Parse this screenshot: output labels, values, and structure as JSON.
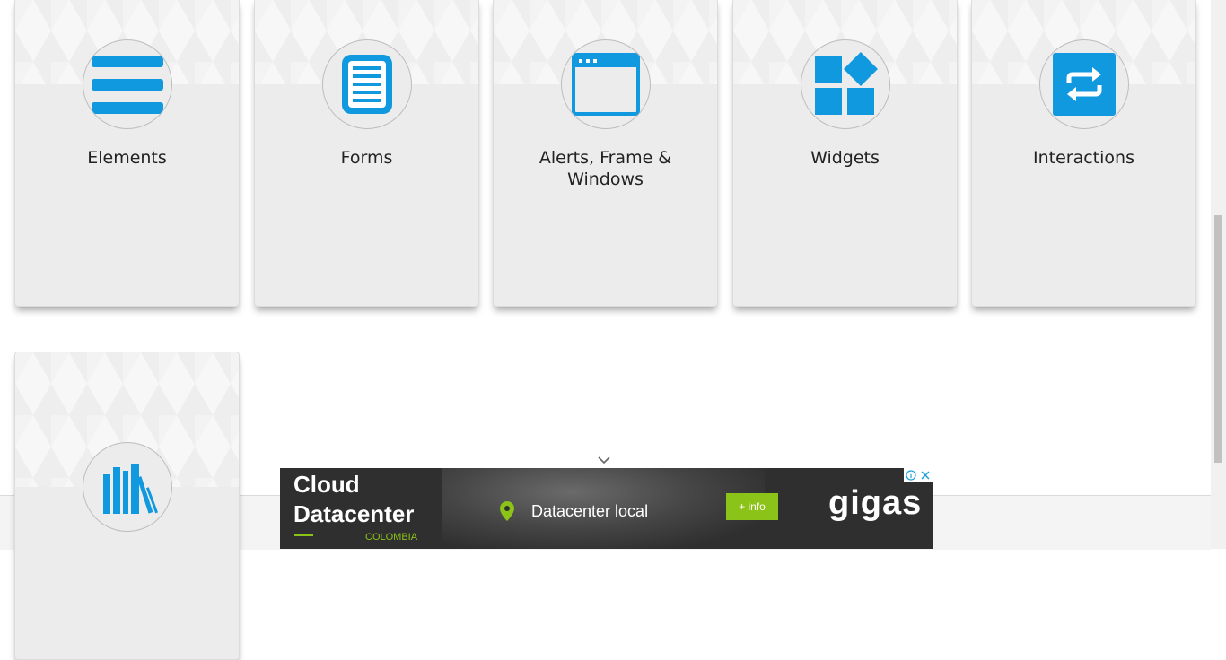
{
  "cards": [
    {
      "title": "Elements",
      "icon": "hamburger-menu-icon"
    },
    {
      "title": "Forms",
      "icon": "document-list-icon"
    },
    {
      "title": "Alerts, Frame & Windows",
      "icon": "browser-window-icon"
    },
    {
      "title": "Widgets",
      "icon": "widgets-blocks-icon"
    },
    {
      "title": "Interactions",
      "icon": "repeat-arrows-icon"
    },
    {
      "title": "",
      "icon": "book-shelf-icon"
    }
  ],
  "ad": {
    "headline_line1": "Cloud",
    "headline_line2": "Datacenter",
    "country": "COLOMBIA",
    "location_text": "Datacenter local",
    "cta": "+ info",
    "brand": "gigas",
    "colors": {
      "accent": "#8cc319",
      "background": "#2f2f2f"
    }
  },
  "colors": {
    "icon_blue": "#1199e0",
    "card_bg": "#ececec"
  }
}
